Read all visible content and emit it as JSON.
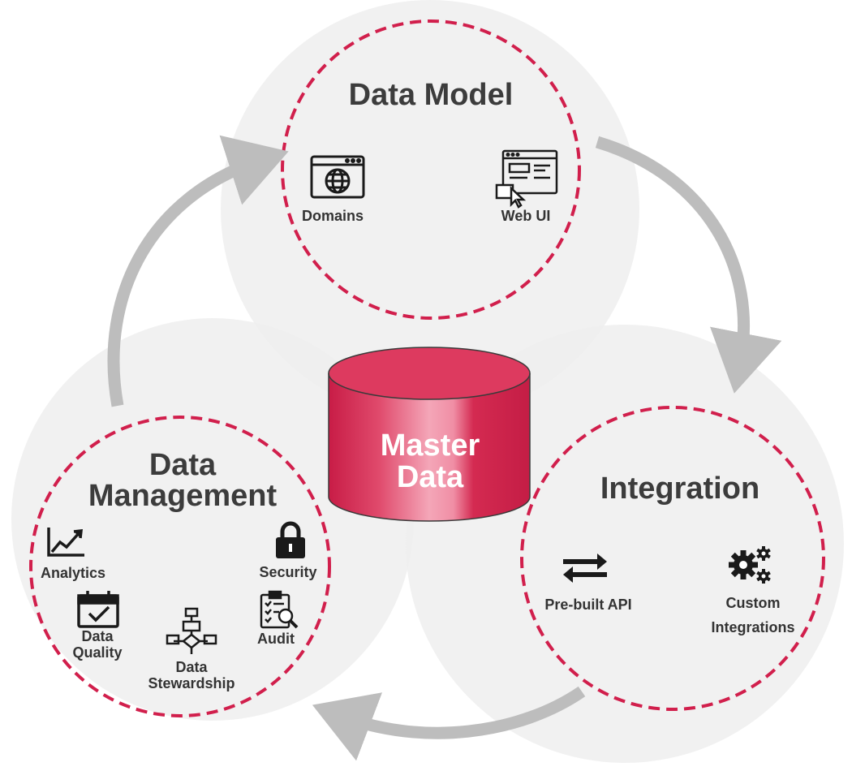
{
  "colors": {
    "accent": "#d11f4c",
    "bubble": "#efefef",
    "arrow": "#bdbdbd",
    "heading": "#3c3c3c",
    "cylinder": "#d42a51",
    "icon": "#1a1a1a"
  },
  "center": {
    "line1": "Master",
    "line2": "Data"
  },
  "data_model": {
    "title": "Data Model",
    "items": [
      {
        "label": "Domains",
        "icon": "browser-globe-icon"
      },
      {
        "label": "Web UI",
        "icon": "web-ui-cursor-icon"
      }
    ]
  },
  "integration": {
    "title": "Integration",
    "items": [
      {
        "label": "Pre-built API",
        "icon": "swap-arrows-icon"
      },
      {
        "label_line1": "Custom",
        "label_line2": "Integrations",
        "icon": "gears-icon"
      }
    ]
  },
  "data_management": {
    "title_line1": "Data",
    "title_line2": "Management",
    "items": [
      {
        "label": "Analytics",
        "icon": "line-chart-icon"
      },
      {
        "label": "Security",
        "icon": "padlock-icon"
      },
      {
        "label_line1": "Data",
        "label_line2": "Quality",
        "icon": "calendar-check-icon"
      },
      {
        "label_line1": "Data",
        "label_line2": "Stewardship",
        "icon": "flowchart-icon"
      },
      {
        "label": "Audit",
        "icon": "clipboard-search-icon"
      }
    ]
  }
}
